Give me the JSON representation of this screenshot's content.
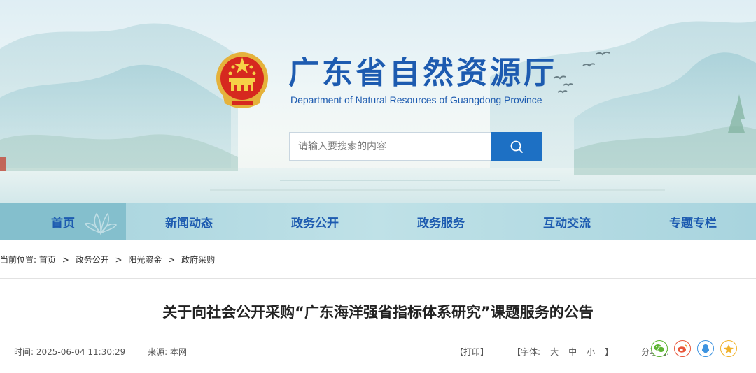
{
  "header": {
    "title": "广东省自然资源厅",
    "subtitle": "Department of Natural Resources of Guangdong Province"
  },
  "search": {
    "placeholder": "请输入要搜索的内容",
    "value": ""
  },
  "nav": {
    "items": [
      {
        "label": "首页",
        "active": true
      },
      {
        "label": "新闻动态"
      },
      {
        "label": "政务公开"
      },
      {
        "label": "政务服务"
      },
      {
        "label": "互动交流"
      },
      {
        "label": "专题专栏"
      }
    ]
  },
  "breadcrumb": {
    "prefix": "当前位置:",
    "items": [
      "首页",
      "政务公开",
      "阳光资金",
      "政府采购"
    ],
    "separator": ">"
  },
  "article": {
    "title": "关于向社会公开采购“广东海洋强省指标体系研究”课题服务的公告",
    "time": "时间: 2025-06-04 11:30:29",
    "source": "来源: 本网",
    "print_label": "【打印】",
    "font_label": "【字体:",
    "font_large": "大",
    "font_medium": "中",
    "font_small": "小",
    "font_close": "】",
    "share_label": "分享到:"
  },
  "share_icons": [
    "wechat-icon",
    "weibo-icon",
    "qq-icon",
    "qzone-icon"
  ],
  "colors": {
    "brand_blue": "#1d5bb0",
    "search_button": "#1d70c4",
    "nav_bg": "#a5d2dd",
    "nav_active": "#84bfcd"
  }
}
